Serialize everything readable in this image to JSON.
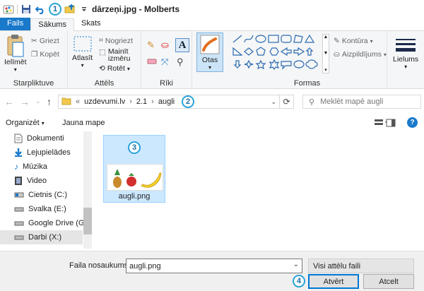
{
  "window": {
    "title": "dārzeņi.jpg - Molberts"
  },
  "callouts": {
    "c1": "1",
    "c2": "2",
    "c3": "3",
    "c4": "4"
  },
  "tabs": [
    {
      "label": "Fails"
    },
    {
      "label": "Sākums"
    },
    {
      "label": "Skats"
    }
  ],
  "ribbon": {
    "starpliktuve": {
      "paste": "Ielīmēt",
      "cut": "Griezt",
      "copy": "Kopēt",
      "group": "Starpliktuve"
    },
    "attels": {
      "select": "Atlasīt",
      "crop": "Nogriezt",
      "resize1": "Mainīt",
      "resize2": "izmēru",
      "rotate": "Rotēt",
      "group": "Attēls"
    },
    "riki": {
      "group": "Rīki",
      "text_tool": "A"
    },
    "brushes": {
      "label": "Otas"
    },
    "formas": {
      "outline": "Kontūra",
      "fill": "Aizpildījums",
      "group": "Formas"
    },
    "lielums": {
      "label": "Lielums"
    }
  },
  "address": {
    "prefix": "«",
    "parts": [
      "uzdevumi.lv",
      "2.1",
      "augli"
    ],
    "sep": "›"
  },
  "search": {
    "placeholder": "Meklēt mapē augli"
  },
  "commands": {
    "organize": "Organizēt",
    "new_folder": "Jauna mape"
  },
  "sidebar": {
    "items": [
      {
        "label": "Dokumenti"
      },
      {
        "label": "Lejupielādes"
      },
      {
        "label": "Mūzika"
      },
      {
        "label": "Video"
      },
      {
        "label": "Cietnis (C:)"
      },
      {
        "label": "Svalka (E:)"
      },
      {
        "label": "Google Drive (G:)"
      },
      {
        "label": "Darbi (X:)"
      }
    ]
  },
  "files": [
    {
      "name": "augli.png"
    }
  ],
  "footer": {
    "filename_label": "Faila nosaukums:",
    "filename_value": "augli.png",
    "filter": "Visi attēlu faili",
    "open": "Atvērt",
    "cancel": "Atcelt"
  },
  "colors": {
    "accent": "#1979ca",
    "callout": "#2aa3d8",
    "selection": "#cce8ff"
  }
}
